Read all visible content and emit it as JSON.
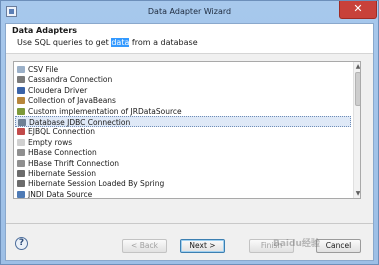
{
  "window": {
    "title": "Data Adapter Wizard",
    "close_glyph": "✕"
  },
  "header": {
    "title": "Data Adapters",
    "desc_before": "Use SQL queries to get ",
    "desc_highlight": "data",
    "desc_after": " from a database"
  },
  "list": {
    "items": [
      {
        "label": "CSV File",
        "icon": "csv-icon",
        "color": "#9bb0c8"
      },
      {
        "label": "Cassandra Connection",
        "icon": "cassandra-icon",
        "color": "#7a7a7a"
      },
      {
        "label": "Cloudera Driver",
        "icon": "cloudera-icon",
        "color": "#3a63a8"
      },
      {
        "label": "Collection of JavaBeans",
        "icon": "javabeans-icon",
        "color": "#b8863b"
      },
      {
        "label": "Custom implementation of JRDataSource",
        "icon": "custom-datasource-icon",
        "color": "#7d9a3a"
      },
      {
        "label": "Database JDBC Connection",
        "icon": "database-icon",
        "color": "#6d7f94"
      },
      {
        "label": "EJBQL Connection",
        "icon": "ejbql-icon",
        "color": "#c24a4a"
      },
      {
        "label": "Empty rows",
        "icon": "empty-rows-icon",
        "color": "#d0d0d0"
      },
      {
        "label": "HBase Connection",
        "icon": "hbase-icon",
        "color": "#8f8f8f"
      },
      {
        "label": "HBase Thrift Connection",
        "icon": "hbase-thrift-icon",
        "color": "#8f8f8f"
      },
      {
        "label": "Hibernate Session",
        "icon": "hibernate-icon",
        "color": "#6b6b6b"
      },
      {
        "label": "Hibernate Session Loaded By Spring",
        "icon": "hibernate-spring-icon",
        "color": "#6b6b6b"
      },
      {
        "label": "JNDI Data Source",
        "icon": "jndi-icon",
        "color": "#4e7ab5"
      }
    ],
    "selected_index": 5
  },
  "footer": {
    "help_glyph": "?",
    "back_label": "< Back",
    "next_label": "Next >",
    "finish_label": "Finish",
    "cancel_label": "Cancel"
  },
  "watermark": "Baidu经验"
}
